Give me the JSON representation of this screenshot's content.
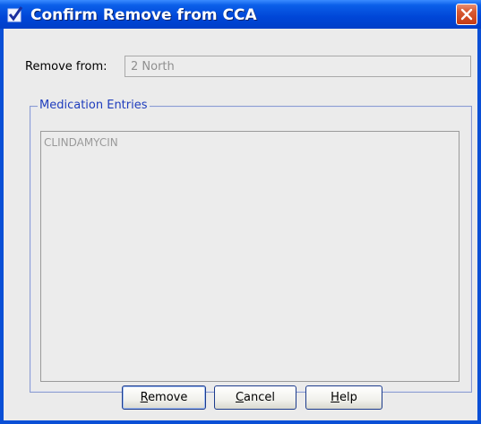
{
  "window": {
    "title": "Confirm Remove from CCA"
  },
  "form": {
    "remove_from_label": "Remove from:",
    "remove_from_value": "2 North"
  },
  "group": {
    "legend": "Medication Entries",
    "items": [
      "CLINDAMYCIN"
    ]
  },
  "buttons": {
    "remove": {
      "mnemonic": "R",
      "rest": "emove"
    },
    "cancel": {
      "mnemonic": "C",
      "rest": "ancel"
    },
    "help": {
      "mnemonic": "H",
      "rest": "elp"
    }
  },
  "icons": {
    "title_icon": "checkbox-checked-icon",
    "close_icon": "close-icon"
  },
  "colors": {
    "titlebar": "#0046d7",
    "client_bg": "#ebebeb",
    "legend_text": "#1f3dbd",
    "close_button": "#d75a33"
  }
}
